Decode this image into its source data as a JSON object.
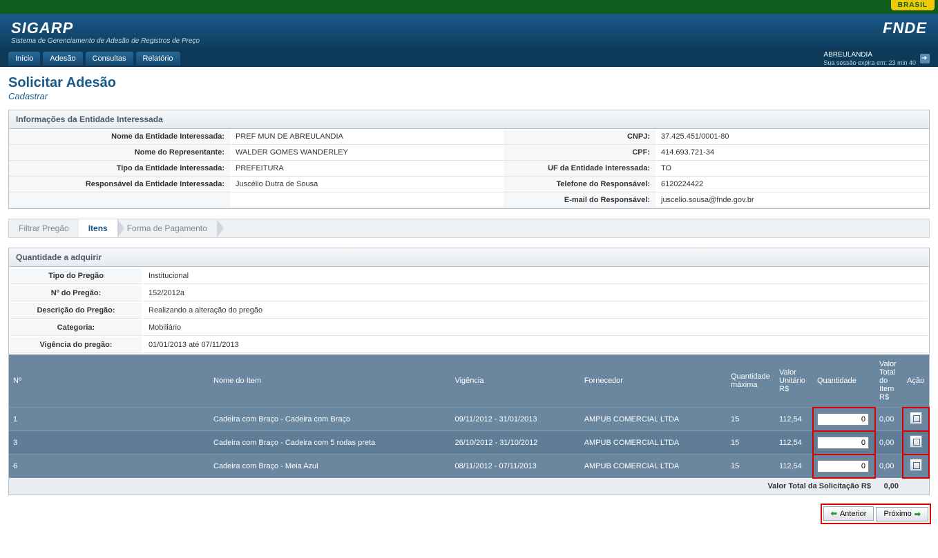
{
  "brasil_badge": "BRASIL",
  "app": {
    "name": "SIGARP",
    "subtitle": "Sistema de Gerenciamento de Adesão de Registros de Preço",
    "org": "FNDE"
  },
  "menu": [
    "Início",
    "Adesão",
    "Consultas",
    "Relatório"
  ],
  "session": {
    "location": "ABREULANDIA",
    "expires": "Sua sessão expira em: 23 min 40"
  },
  "page": {
    "title": "Solicitar Adesão",
    "subtitle": "Cadastrar"
  },
  "entity_panel": {
    "title": "Informações da Entidade Interessada",
    "rows": [
      {
        "l1": "Nome da Entidade Interessada:",
        "v1": "PREF MUN DE ABREULANDIA",
        "l2": "CNPJ:",
        "v2": "37.425.451/0001-80"
      },
      {
        "l1": "Nome do Representante:",
        "v1": "WALDER GOMES WANDERLEY",
        "l2": "CPF:",
        "v2": "414.693.721-34"
      },
      {
        "l1": "Tipo da Entidade Interessada:",
        "v1": "PREFEITURA",
        "l2": "UF da Entidade Interessada:",
        "v2": "TO"
      },
      {
        "l1": "Responsável da Entidade Interessada:",
        "v1": "Juscélio Dutra de Sousa",
        "l2": "Telefone do Responsável:",
        "v2": "6120224422"
      },
      {
        "l1": "",
        "v1": "",
        "l2": "E-mail do Responsável:",
        "v2": "juscelio.sousa@fnde.gov.br"
      }
    ]
  },
  "steps": [
    "Filtrar Pregão",
    "Itens",
    "Forma de Pagamento"
  ],
  "steps_active": 1,
  "acquire_panel": {
    "title": "Quantidade a adquirir",
    "meta": [
      {
        "label": "Tipo do Pregão",
        "value": "Institucional"
      },
      {
        "label": "Nº do Pregão:",
        "value": "152/2012a"
      },
      {
        "label": "Descrição do Pregão:",
        "value": "Realizando a alteração do pregão"
      },
      {
        "label": "Categoria:",
        "value": "Mobiliário"
      },
      {
        "label": "Vigência do pregão:",
        "value": "01/01/2013 até 07/11/2013"
      }
    ],
    "columns": [
      "Nº",
      "Nome do Item",
      "Vigência",
      "Fornecedor",
      "Quantidade máxima",
      "Valor Unitário R$",
      "Quantidade",
      "Valor Total do Item R$",
      "Ação"
    ],
    "rows": [
      {
        "n": "1",
        "nome": "Cadeira com Braço - Cadeira com Braço",
        "vig": "09/11/2012 - 31/01/2013",
        "forn": "AMPUB COMERCIAL LTDA",
        "qmax": "15",
        "vu": "112,54",
        "qty": "0",
        "vt": "0,00"
      },
      {
        "n": "3",
        "nome": "Cadeira com Braço - Cadeira com 5 rodas preta",
        "vig": "26/10/2012 - 31/10/2012",
        "forn": "AMPUB COMERCIAL LTDA",
        "qmax": "15",
        "vu": "112,54",
        "qty": "0",
        "vt": "0,00"
      },
      {
        "n": "6",
        "nome": "Cadeira com Braço - Meia Azul",
        "vig": "08/11/2012 - 07/11/2013",
        "forn": "AMPUB COMERCIAL LTDA",
        "qmax": "15",
        "vu": "112,54",
        "qty": "0",
        "vt": "0,00"
      }
    ],
    "total_label": "Valor Total da Solicitação R$",
    "total_value": "0,00"
  },
  "buttons": {
    "prev": "Anterior",
    "next": "Próximo"
  }
}
